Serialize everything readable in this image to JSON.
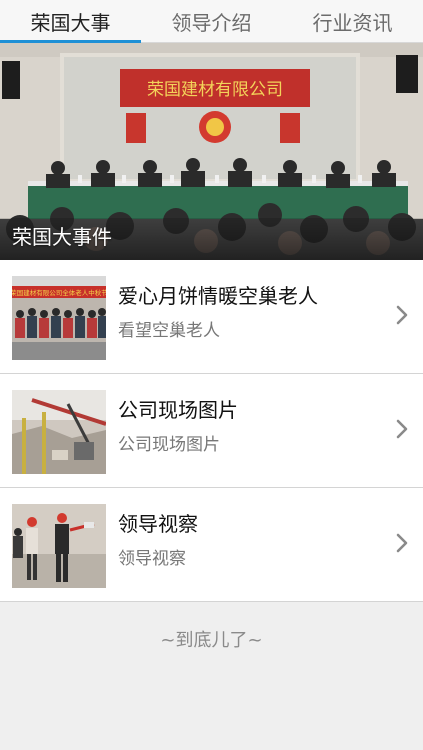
{
  "tabs": [
    {
      "label": "荣国大事",
      "active": true
    },
    {
      "label": "领导介绍",
      "active": false
    },
    {
      "label": "行业资讯",
      "active": false
    }
  ],
  "accent_color": "#1e90d6",
  "hero": {
    "caption": "荣国大事件",
    "banner_text": "荣国建材有限公司"
  },
  "items": [
    {
      "title": "爱心月饼情暖空巢老人",
      "subtitle": "看望空巢老人"
    },
    {
      "title": "公司现场图片",
      "subtitle": "公司现场图片"
    },
    {
      "title": "领导视察",
      "subtitle": "领导视察"
    }
  ],
  "thumb1_banner": "荣国建材有限公司全体老人中秋节",
  "footer": "~到底儿了~"
}
